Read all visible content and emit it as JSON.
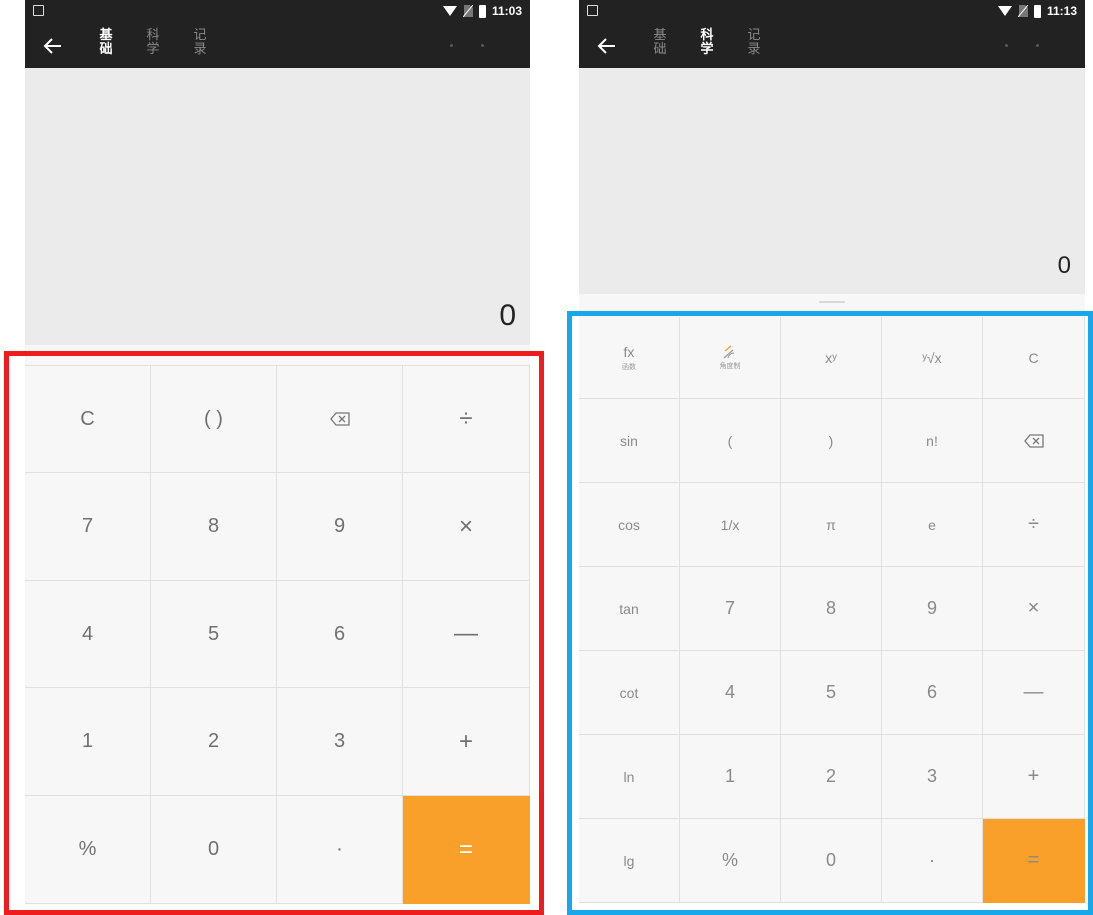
{
  "colors": {
    "accent": "#f9a02a",
    "bar": "#222222",
    "display": "#ebebeb",
    "red_frame": "#ee1c1c",
    "blue_frame": "#16a8ea"
  },
  "left": {
    "status": {
      "time": "11:03"
    },
    "tabs": [
      {
        "line1": "基",
        "line2": "础"
      },
      {
        "line1": "科",
        "line2": "学"
      },
      {
        "line1": "记",
        "line2": "录"
      }
    ],
    "active_tab": 0,
    "display": {
      "result": "0"
    },
    "keys": [
      {
        "label": "C",
        "name": "clear"
      },
      {
        "label": "( )",
        "name": "parentheses"
      },
      {
        "label": "",
        "name": "backspace",
        "icon": "backspace-icon"
      },
      {
        "label": "÷",
        "name": "divide"
      },
      {
        "label": "7",
        "name": "digit-7"
      },
      {
        "label": "8",
        "name": "digit-8"
      },
      {
        "label": "9",
        "name": "digit-9"
      },
      {
        "label": "×",
        "name": "multiply"
      },
      {
        "label": "4",
        "name": "digit-4"
      },
      {
        "label": "5",
        "name": "digit-5"
      },
      {
        "label": "6",
        "name": "digit-6"
      },
      {
        "label": "—",
        "name": "subtract"
      },
      {
        "label": "1",
        "name": "digit-1"
      },
      {
        "label": "2",
        "name": "digit-2"
      },
      {
        "label": "3",
        "name": "digit-3"
      },
      {
        "label": "+",
        "name": "add"
      },
      {
        "label": "%",
        "name": "percent"
      },
      {
        "label": "0",
        "name": "digit-0"
      },
      {
        "label": "·",
        "name": "decimal-point"
      },
      {
        "label": "=",
        "name": "equals"
      }
    ]
  },
  "right": {
    "status": {
      "time": "11:13"
    },
    "tabs": [
      {
        "line1": "基",
        "line2": "础"
      },
      {
        "line1": "科",
        "line2": "学"
      },
      {
        "line1": "记",
        "line2": "录"
      }
    ],
    "active_tab": 1,
    "display": {
      "result": "0"
    },
    "keys": [
      {
        "label": "fx",
        "sub": "函数",
        "name": "function"
      },
      {
        "label": "",
        "sub": "角度制",
        "name": "angle-mode",
        "icon": "angle-icon"
      },
      {
        "label": "xʸ",
        "name": "power"
      },
      {
        "label": "ʸ√x",
        "name": "root"
      },
      {
        "label": "C",
        "name": "clear"
      },
      {
        "label": "sin",
        "name": "sin"
      },
      {
        "label": "(",
        "name": "open-paren"
      },
      {
        "label": ")",
        "name": "close-paren"
      },
      {
        "label": "n!",
        "name": "factorial"
      },
      {
        "label": "",
        "name": "backspace",
        "icon": "backspace-icon"
      },
      {
        "label": "cos",
        "name": "cos"
      },
      {
        "label": "1/x",
        "name": "reciprocal"
      },
      {
        "label": "π",
        "name": "pi"
      },
      {
        "label": "e",
        "name": "euler"
      },
      {
        "label": "÷",
        "name": "divide"
      },
      {
        "label": "tan",
        "name": "tan"
      },
      {
        "label": "7",
        "name": "digit-7"
      },
      {
        "label": "8",
        "name": "digit-8"
      },
      {
        "label": "9",
        "name": "digit-9"
      },
      {
        "label": "×",
        "name": "multiply"
      },
      {
        "label": "cot",
        "name": "cot"
      },
      {
        "label": "4",
        "name": "digit-4"
      },
      {
        "label": "5",
        "name": "digit-5"
      },
      {
        "label": "6",
        "name": "digit-6"
      },
      {
        "label": "—",
        "name": "subtract"
      },
      {
        "label": "ln",
        "name": "ln"
      },
      {
        "label": "1",
        "name": "digit-1"
      },
      {
        "label": "2",
        "name": "digit-2"
      },
      {
        "label": "3",
        "name": "digit-3"
      },
      {
        "label": "+",
        "name": "add"
      },
      {
        "label": "lg",
        "name": "lg"
      },
      {
        "label": "%",
        "name": "percent"
      },
      {
        "label": "0",
        "name": "digit-0"
      },
      {
        "label": "·",
        "name": "decimal-point"
      },
      {
        "label": "=",
        "name": "equals"
      }
    ]
  }
}
